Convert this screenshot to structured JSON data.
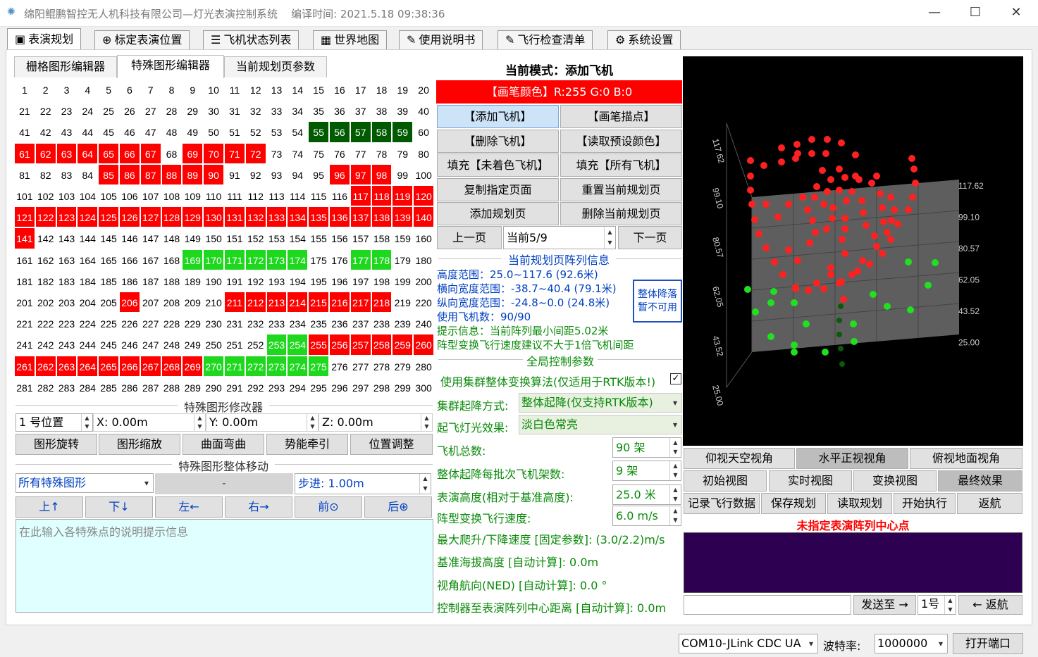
{
  "window": {
    "title": "绵阳鲲鹏智控无人机科技有限公司—灯光表演控制系统",
    "compile_time": "编译时间: 2021.5.18 09:38:36",
    "minimize": "—",
    "maximize": "☐",
    "close": "✕"
  },
  "tabs": [
    {
      "label": "表演规划",
      "icon": "▣"
    },
    {
      "label": "标定表演位置",
      "icon": "⊕"
    },
    {
      "label": "飞机状态列表",
      "icon": "☰"
    },
    {
      "label": "世界地图",
      "icon": "▦"
    },
    {
      "label": "使用说明书",
      "icon": "✎"
    },
    {
      "label": "飞行检查清单",
      "icon": "✎"
    },
    {
      "label": "系统设置",
      "icon": "⚙"
    }
  ],
  "subtabs": [
    "栅格图形编辑器",
    "特殊图形编辑器",
    "当前规划页参数"
  ],
  "grid": {
    "red": [
      61,
      62,
      63,
      64,
      65,
      66,
      67,
      69,
      70,
      71,
      72,
      85,
      86,
      87,
      88,
      89,
      90,
      96,
      97,
      98,
      117,
      118,
      119,
      120,
      121,
      122,
      123,
      124,
      125,
      126,
      127,
      128,
      129,
      130,
      131,
      132,
      133,
      134,
      135,
      136,
      137,
      138,
      139,
      140,
      141,
      206,
      211,
      212,
      213,
      214,
      215,
      216,
      217,
      218,
      255,
      256,
      257,
      258,
      259,
      260,
      261,
      262,
      263,
      264,
      265,
      266,
      267,
      268,
      269
    ],
    "green": [
      169,
      170,
      171,
      172,
      173,
      174,
      177,
      178,
      253,
      254,
      270,
      271,
      272,
      273,
      274,
      275
    ],
    "dark_green": [
      55,
      56,
      57,
      58,
      59
    ]
  },
  "modifier": {
    "title": "特殊图形修改器",
    "position": "1 号位置",
    "x": "X:  0.00m",
    "y": "Y:  0.00m",
    "z": "Z:  0.00m",
    "buttons": [
      "图形旋转",
      "图形缩放",
      "曲面弯曲",
      "势能牵引",
      "位置调整"
    ]
  },
  "move": {
    "title": "特殊图形整体移动",
    "target": "所有特殊图形",
    "placeholder_mid": "-",
    "step": "步进: 1.00m",
    "buttons": [
      "上↑",
      "下↓",
      "左←",
      "右→",
      "前⊙",
      "后⊕"
    ],
    "note_placeholder": "在此输入各特殊点的说明提示信息"
  },
  "mode": {
    "title": "当前模式：添加飞机",
    "pen_color": "【画笔颜色】R:255 G:0 B:0"
  },
  "actions": [
    [
      "【添加飞机】",
      "【画笔描点】"
    ],
    [
      "【删除飞机】",
      "【读取预设颜色】"
    ],
    [
      "填充【未着色飞机】",
      "填充【所有飞机】"
    ],
    [
      "复制指定页面",
      "重置当前规划页"
    ],
    [
      "添加规划页",
      "删除当前规划页"
    ]
  ],
  "paging": {
    "prev": "上一页",
    "current": "当前5/9",
    "next": "下一页"
  },
  "info": {
    "title": "当前规划页阵列信息",
    "lines": [
      "高度范围：25.0~117.6 (92.6米)",
      "横向宽度范围：-38.7~40.4 (79.1米)",
      "纵向宽度范围：-24.8~0.0 (24.8米)",
      "使用飞机数：90/90"
    ],
    "tip1": "提示信息：当前阵列最小间距5.02米",
    "tip2": "阵型变换飞行速度建议不大于1倍飞机间距",
    "landing_btn1": "整体降落",
    "landing_btn2": "暂不可用"
  },
  "global": {
    "title": "全局控制参数",
    "rtk_algo": "使用集群整体变换算法(仅适用于RTK版本!)",
    "rtk_checked": "✓",
    "lift_label": "集群起降方式:",
    "lift_value": "整体起降(仅支持RTK版本)",
    "light_label": "起飞灯光效果:",
    "light_value": "淡白色常亮",
    "total_label": "飞机总数:",
    "total_value": "90 架",
    "batch_label": "整体起降每批次飞机架数:",
    "batch_value": "9 架",
    "height_label": "表演高度(相对于基准高度):",
    "height_value": "25.0 米",
    "speed_label": "阵型变换飞行速度:",
    "speed_value": "6.0 m/s",
    "climb": "最大爬升/下降速度 [固定参数]: (3.0/2.2)m/s",
    "alt": "基准海拔高度 [自动计算]: 0.0m",
    "heading": "视角航向(NED) [自动计算]: 0.0 °",
    "distance": "控制器至表演阵列中心距离 [自动计算]: 0.0m"
  },
  "view": {
    "axis_right": [
      "117.62",
      "99.10",
      "80.57",
      "62.05",
      "43.52",
      "25.00"
    ],
    "axis_left": [
      "117.62",
      "99.10",
      "80.57",
      "62.05",
      "43.52",
      "25.00"
    ],
    "btn_row1": [
      "仰视天空视角",
      "水平正视视角",
      "俯视地面视角"
    ],
    "btn_row2": [
      "初始视图",
      "实时视图",
      "变换视图",
      "最终效果"
    ],
    "btn_row3": [
      "记录飞行数据",
      "保存规划",
      "读取规划",
      "开始执行",
      "返航"
    ],
    "warning": "未指定表演阵列中心点",
    "send": "发送至 →",
    "target": "1号",
    "return": "← 返航"
  },
  "status": {
    "port": "COM10-JLink CDC UA",
    "baud_label": "波特率:",
    "baud": "1000000",
    "open": "打开端口"
  },
  "colors": {
    "red": "#ff0000",
    "green": "#1ed81e",
    "dark_green": "#005a00",
    "purple": "#2d0052"
  }
}
